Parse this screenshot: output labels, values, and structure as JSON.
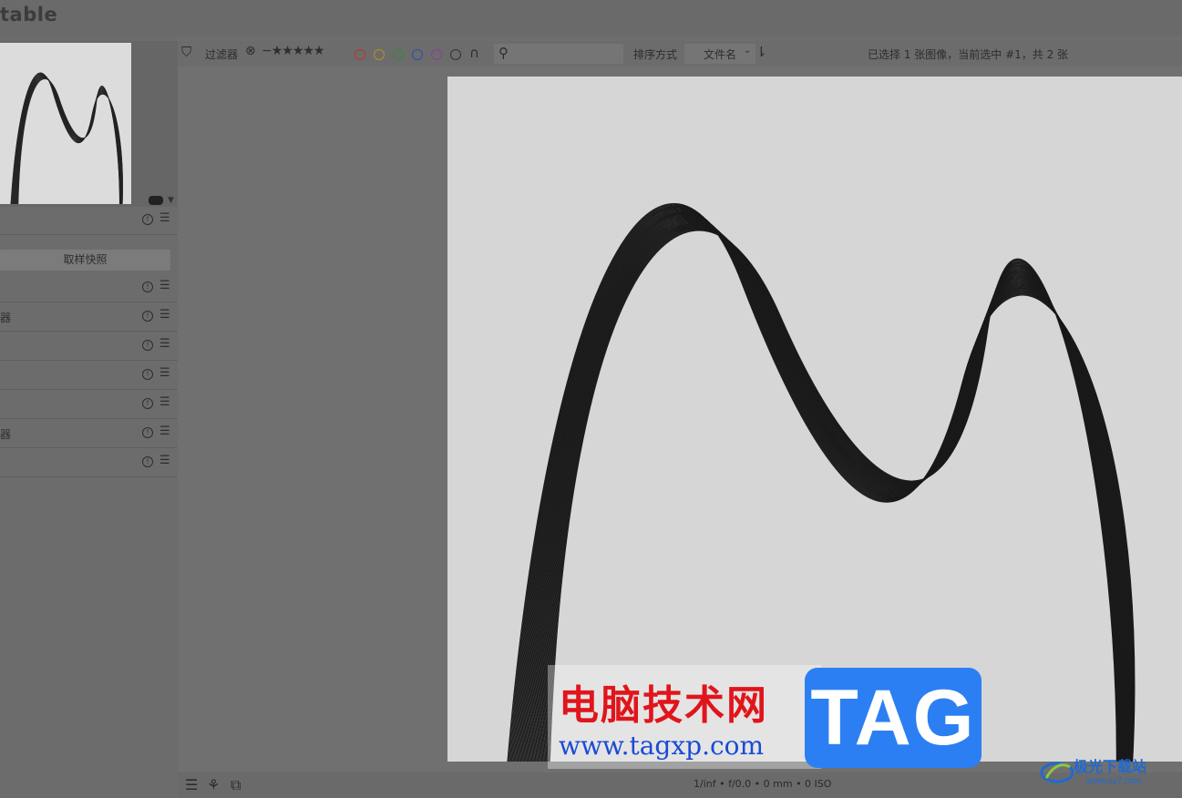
{
  "app": {
    "title": "table"
  },
  "left_panel": {
    "snapshot_button": "取样快照",
    "module_rows": [
      {
        "label": ""
      },
      {
        "label": ""
      },
      {
        "label": "器"
      },
      {
        "label": ""
      },
      {
        "label": ""
      },
      {
        "label": ""
      },
      {
        "label": "器"
      },
      {
        "label": ""
      }
    ]
  },
  "toolbar": {
    "filter_label": "过滤器",
    "reject_icon": "⊗",
    "stars": "−★★★★★",
    "color_labels": [
      {
        "name": "red",
        "color": "#c0392b"
      },
      {
        "name": "yellow",
        "color": "#c79a12"
      },
      {
        "name": "green",
        "color": "#2e8b3a"
      },
      {
        "name": "blue",
        "color": "#2b4fb0"
      },
      {
        "name": "purple",
        "color": "#9b3fa8"
      },
      {
        "name": "gray",
        "color": "#3a3a3a"
      }
    ],
    "sort_label": "排序方式",
    "sort_value": "文件名",
    "selection_status": "已选择 1 张图像，当前选中 #1，共 2 张"
  },
  "bottom_bar": {
    "exif": "1/inf • f/0.0 • 0 mm • 0 ISO"
  },
  "watermark": {
    "cn": "电脑技术网",
    "url": "www.tagxp.com",
    "tag": "TAG",
    "site2": "极光下载站",
    "site2_url": "www.xz7.com"
  }
}
